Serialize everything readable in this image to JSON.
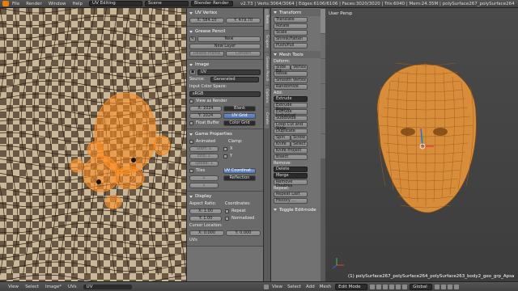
{
  "topbar": {
    "menus": [
      "File",
      "Render",
      "Window",
      "Help"
    ],
    "screen_layout": "UV Editing",
    "scene": "Scene",
    "engine": "Blender Render",
    "stats": "v2.73 | Verts:3064/3064 | Edges:6106/6106 | Faces:3020/3020 | Tris:6040 | Mem:24.35M | polySurface267_polySurface264"
  },
  "uv_vertex": {
    "header": "UV Vertex",
    "x_label": "X:",
    "x_value": "584.10",
    "y_label": "Y:",
    "y_value": "479.70"
  },
  "grease_pencil": {
    "header": "Grease Pencil",
    "new_label": "New",
    "new_layer_label": "New Layer",
    "delete_frame_label": "Delete Frame",
    "convert_label": "Convert"
  },
  "image": {
    "header": "Image",
    "image_name": "UV",
    "source_label": "Source:",
    "source_value": "Generated",
    "color_space_label": "Input Color Space:",
    "color_space_value": "sRGB",
    "view_as_render": "View as Render",
    "x_label": "X:",
    "x_value": "1024",
    "y_label": "Y:",
    "y_value": "1024",
    "float_buffer": "Float Buffer",
    "gen_types": [
      "Blank",
      "UV Grid",
      "Color Grid"
    ],
    "gen_active": "UV Grid"
  },
  "game_props": {
    "header": "Game Properties",
    "animated": "Animated",
    "clamp": "Clamp:",
    "start": "Start:",
    "start_val": "0",
    "end": "End:",
    "end_val": "1",
    "speed": "Speed:",
    "speed_val": "1",
    "clamp_x": "X",
    "clamp_y": "Y",
    "tiles": "Tiles",
    "tx_val": "1",
    "ty_val": "1",
    "uv_coord": "UV Coordinat...",
    "reflection": "Reflection"
  },
  "display": {
    "header": "Display",
    "aspect_label": "Aspect Ratio:",
    "coords_label": "Coordinates:",
    "ax_label": "X:",
    "ax_val": "1.00",
    "ay_label": "Y:",
    "ay_val": "1.00",
    "repeat": "Repeat",
    "normalized": "Normalized",
    "cursor_label": "Cursor Location:",
    "cx_label": "X:",
    "cx_val": "0.000",
    "cy_label": "Y:",
    "cy_val": "0.000",
    "uvs_label": "UVs"
  },
  "uv_footer": {
    "menus": [
      "View",
      "Select",
      "Image*",
      "UVs"
    ],
    "image_name": "UV"
  },
  "properties_tabs": [
    "Tools",
    "Scopes",
    "Grease Pencil",
    "Options",
    "Create"
  ],
  "tools": {
    "transform_header": "Transform",
    "transform_items": [
      "Translate",
      "Rotate",
      "Scale",
      "Shrink/Fatten",
      "Push/Pull"
    ],
    "mesh_header": "Mesh Tools",
    "deform_label": "Deform:",
    "slide_edge": "Slide Ed",
    "vertex": "Vertex",
    "deform_items": [
      "Noise",
      "Smooth Vertex",
      "Randomize"
    ],
    "add_label": "Add:",
    "extrude_select": "Extrude",
    "add_items": [
      "Extrude Region",
      "Extrude Individual",
      "Subdivide",
      "Loop Cut and Slide",
      "Duplicate"
    ],
    "spin": "Spin",
    "screw": "Screw",
    "knife": "Knife",
    "select": "Select",
    "knife_project": "Knife Project",
    "bisect": "Bisect",
    "remove_label": "Remove:",
    "delete_select": "Delete",
    "merge_select": "Merge",
    "remove_doubles": "Remove Doubles",
    "repeat_label": "Repeat:",
    "repeat_last": "Repeat Last",
    "history": "History ...",
    "toggle_editmode": "Toggle Editmode"
  },
  "viewport": {
    "label": "User Persp",
    "status": "(1) polySurface267_polySurface264_polySurface263_body2_geo_grp_Apsa"
  },
  "foot3d": {
    "menus": [
      "View",
      "Select",
      "Add",
      "Mesh"
    ],
    "mode": "Edit Mode",
    "orientation": "Global"
  },
  "colors": {
    "uv_orange": "#ff8a1a",
    "head_orange": "#f29a3a",
    "blue_button": "#5a80c0"
  }
}
